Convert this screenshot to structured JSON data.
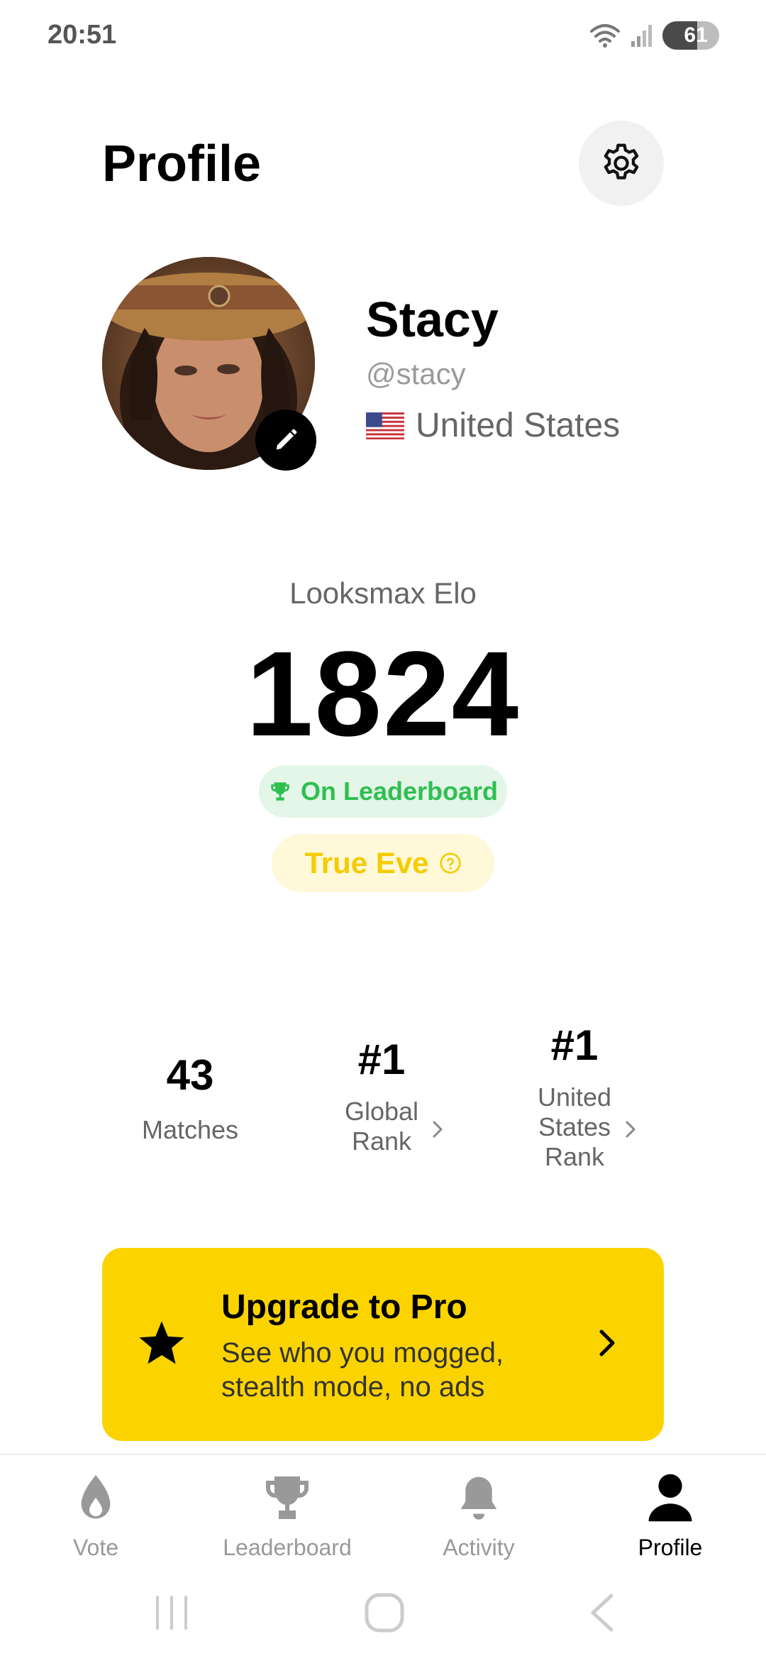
{
  "status": {
    "time": "20:51",
    "battery": "61",
    "battery_level": 0.61
  },
  "header": {
    "title": "Profile",
    "settings_icon": "gear-icon"
  },
  "user": {
    "name": "Stacy",
    "handle": "@stacy",
    "country": "United States",
    "flag_icon": "us-flag-icon"
  },
  "elo": {
    "label": "Looksmax Elo",
    "value": "1824",
    "leaderboard_badge": "On Leaderboard",
    "tier": "True Eve"
  },
  "stats": {
    "matches": {
      "value": "43",
      "label": "Matches"
    },
    "global_rank": {
      "value": "#1",
      "label_line1": "Global",
      "label_line2": "Rank"
    },
    "country_rank": {
      "value": "#1",
      "label_line1": "United",
      "label_line2": "States",
      "label_line3": "Rank"
    }
  },
  "pro": {
    "title": "Upgrade to Pro",
    "description": "See who you mogged, stealth mode, no ads"
  },
  "nav": [
    {
      "label": "Vote",
      "icon": "drop-icon",
      "active": false
    },
    {
      "label": "Leaderboard",
      "icon": "trophy-icon",
      "active": false
    },
    {
      "label": "Activity",
      "icon": "bell-icon",
      "active": false
    },
    {
      "label": "Profile",
      "icon": "person-icon",
      "active": true
    }
  ],
  "colors": {
    "accent_yellow": "#fbd400",
    "leaderboard_green": "#2fbf51",
    "tier_yellow": "#f5cc00"
  }
}
